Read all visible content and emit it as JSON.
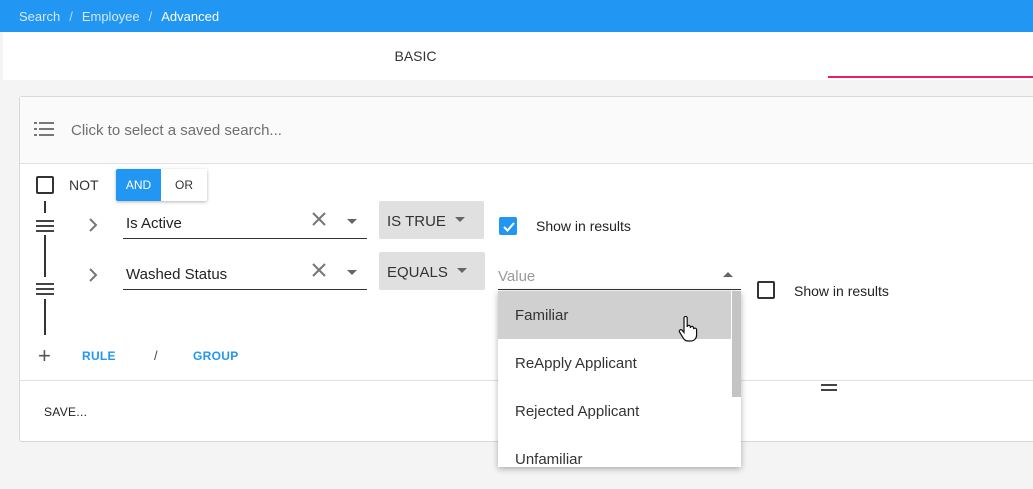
{
  "breadcrumb": [
    "Search",
    "Employee",
    "Advanced"
  ],
  "tabs": {
    "basic": "BASIC"
  },
  "saved_search": {
    "placeholder": "Click to select a saved search..."
  },
  "group": {
    "not_label": "NOT",
    "and_label": "AND",
    "or_label": "OR",
    "and_selected": true
  },
  "rules": [
    {
      "field": "Is Active",
      "operator": "IS TRUE",
      "show_in_results": true,
      "show_label": "Show in results"
    },
    {
      "field": "Washed Status",
      "operator": "EQUALS",
      "value_placeholder": "Value",
      "show_in_results": false,
      "show_label": "Show in results"
    }
  ],
  "actions": {
    "rule": "RULE",
    "separator": "/",
    "group": "GROUP",
    "save": "SAVE..."
  },
  "dropdown_options": [
    "Familiar",
    "ReApply Applicant",
    "Rejected Applicant",
    "Unfamiliar"
  ],
  "colors": {
    "accent": "#2196f3",
    "tab_indicator": "#e91e63"
  }
}
